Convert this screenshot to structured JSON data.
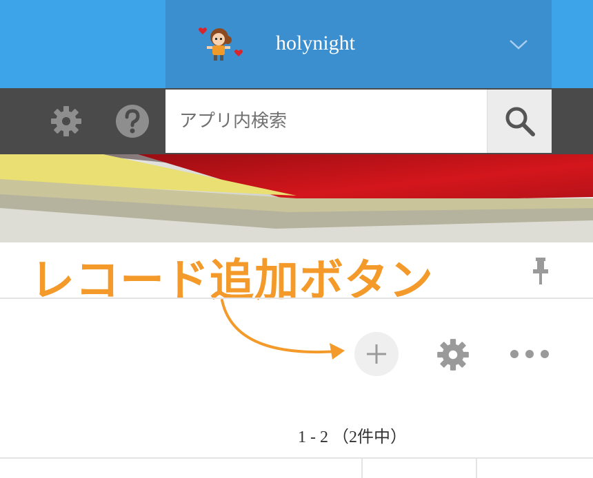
{
  "header": {
    "username": "holynight",
    "avatar_icon": "character-avatar-icon",
    "dropdown_icon": "chevron-down-icon"
  },
  "toolbar": {
    "settings_icon": "gear-icon",
    "help_icon": "help-icon",
    "search": {
      "placeholder": "アプリ内検索",
      "button_icon": "search-icon"
    }
  },
  "content": {
    "annotation_label": "レコード追加ボタン",
    "pin_icon": "pin-icon",
    "add_record_icon": "plus-icon",
    "settings_icon": "gear-icon",
    "more_icon": "ellipsis-icon",
    "pagination": "1 - 2 （2件中）"
  },
  "colors": {
    "top_bar": "#3ea4ea",
    "user_panel": "#3b8fcf",
    "toolbar": "#4a4a4a",
    "annotation": "#f39a2a"
  }
}
